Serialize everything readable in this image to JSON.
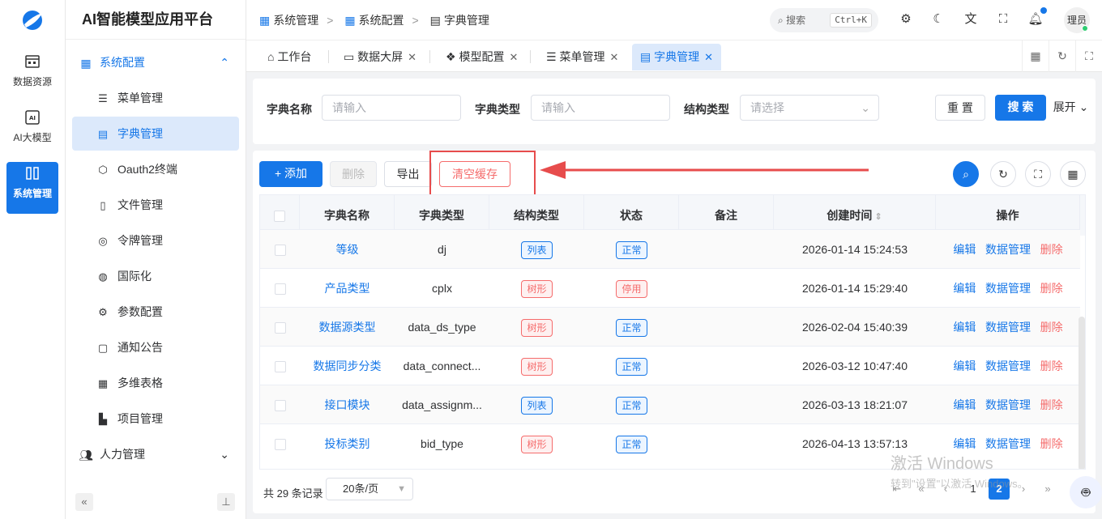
{
  "app": {
    "brand": "AI智能模型应用平台"
  },
  "rail": [
    {
      "label": "数据资源",
      "icon": "database-icon"
    },
    {
      "label": "AI大模型",
      "icon": "ai-icon"
    },
    {
      "label": "系统管理",
      "icon": "system-icon",
      "active": true
    }
  ],
  "sidebar": {
    "group1": "系统配置",
    "items": [
      {
        "label": "菜单管理",
        "icon": "list-icon"
      },
      {
        "label": "字典管理",
        "icon": "dict-icon",
        "active": true
      },
      {
        "label": "Oauth2终端",
        "icon": "hexagon-icon"
      },
      {
        "label": "文件管理",
        "icon": "file-icon"
      },
      {
        "label": "令牌管理",
        "icon": "token-icon"
      },
      {
        "label": "国际化",
        "icon": "globe-icon"
      },
      {
        "label": "参数配置",
        "icon": "config-icon"
      },
      {
        "label": "通知公告",
        "icon": "notice-icon"
      },
      {
        "label": "多维表格",
        "icon": "table-icon"
      },
      {
        "label": "项目管理",
        "icon": "project-icon"
      }
    ],
    "group2": "人力管理"
  },
  "header": {
    "breadcrumb": [
      "系统管理",
      "系统配置",
      "字典管理"
    ],
    "search_label": "搜索",
    "search_shortcut": "Ctrl+K",
    "avatar": "理员"
  },
  "tabs": [
    {
      "label": "工作台",
      "icon": "home-icon"
    },
    {
      "label": "数据大屏",
      "icon": "monitor-icon",
      "closable": true
    },
    {
      "label": "模型配置",
      "icon": "cubes-icon",
      "closable": true
    },
    {
      "label": "菜单管理",
      "icon": "list-icon",
      "closable": true
    },
    {
      "label": "字典管理",
      "icon": "dict-icon",
      "closable": true,
      "active": true
    }
  ],
  "filter": {
    "name_label": "字典名称",
    "name_placeholder": "请输入",
    "type_label": "字典类型",
    "type_placeholder": "请输入",
    "struct_label": "结构类型",
    "struct_placeholder": "请选择",
    "reset": "重 置",
    "search": "搜 索",
    "expand": "展开"
  },
  "toolbar": {
    "add": "+ 添加",
    "delete": "删除",
    "export": "导出",
    "clear_cache": "清空缓存"
  },
  "accent": "#1677e8",
  "table": {
    "columns": [
      "字典名称",
      "字典类型",
      "结构类型",
      "状态",
      "备注",
      "创建时间",
      "操作"
    ],
    "rows": [
      {
        "name": "等级",
        "type": "dj",
        "struct": "列表",
        "struct_color": "blue",
        "status": "正常",
        "status_color": "blue",
        "remark": "",
        "created": "2026-01-14 15:24:53"
      },
      {
        "name": "产品类型",
        "type": "cplx",
        "struct": "树形",
        "struct_color": "red",
        "status": "停用",
        "status_color": "red",
        "remark": "",
        "created": "2026-01-14 15:29:40"
      },
      {
        "name": "数据源类型",
        "type": "data_ds_type",
        "struct": "树形",
        "struct_color": "red",
        "status": "正常",
        "status_color": "blue",
        "remark": "",
        "created": "2026-02-04 15:40:39"
      },
      {
        "name": "数据同步分类",
        "type": "data_connect...",
        "struct": "树形",
        "struct_color": "red",
        "status": "正常",
        "status_color": "blue",
        "remark": "",
        "created": "2026-03-12 10:47:40"
      },
      {
        "name": "接口模块",
        "type": "data_assignm...",
        "struct": "列表",
        "struct_color": "blue",
        "status": "正常",
        "status_color": "blue",
        "remark": "",
        "created": "2026-03-13 18:21:07"
      },
      {
        "name": "投标类别",
        "type": "bid_type",
        "struct": "树形",
        "struct_color": "red",
        "status": "正常",
        "status_color": "blue",
        "remark": "",
        "created": "2026-04-13 13:57:13"
      }
    ],
    "actions": {
      "edit": "编辑",
      "data": "数据管理",
      "delete": "删除"
    }
  },
  "pager": {
    "total": "共 29 条记录",
    "size": "20条/页",
    "pages": [
      "1",
      "2"
    ],
    "current": "2"
  },
  "watermark": {
    "line1": "激活 Windows",
    "line2": "转到\"设置\"以激活 Windows。"
  }
}
